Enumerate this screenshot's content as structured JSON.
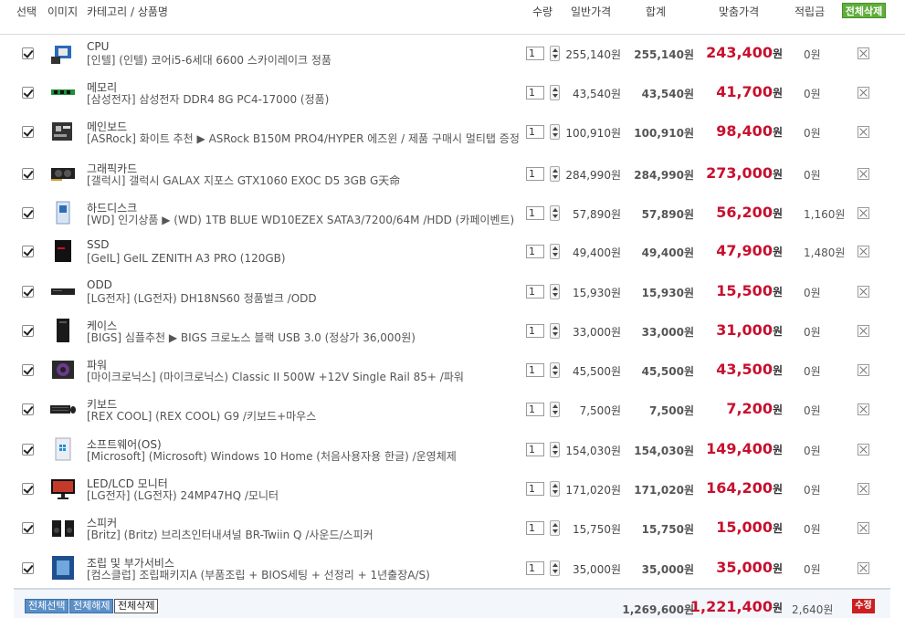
{
  "header": {
    "select": "선택",
    "image": "이미지",
    "category_product": "카테고리 / 상품명",
    "qty": "수량",
    "normal_price": "일반가격",
    "sum": "합계",
    "fit_price": "맞춤가격",
    "points": "적립금",
    "delete_all": "전체삭제"
  },
  "currency": "원",
  "items": [
    {
      "category": "CPU",
      "name": "[인텔] (인텔) 코어i5-6세대 6600 스카이레이크 정품",
      "qty": "1",
      "normal": "255,140원",
      "sum": "255,140원",
      "fit": "243,400",
      "points": "0원",
      "icon": "cpu-icon"
    },
    {
      "category": "메모리",
      "name": "[삼성전자] 삼성전자 DDR4 8G PC4-17000 (정품)",
      "qty": "1",
      "normal": "43,540원",
      "sum": "43,540원",
      "fit": "41,700",
      "points": "0원",
      "icon": "memory-icon"
    },
    {
      "category": "메인보드",
      "name": "[ASRock] 화이트 추천 ▶ ASRock B150M PRO4/HYPER 에즈윈 / 제품 구매시 멀티탭 증정",
      "qty": "1",
      "normal": "100,910원",
      "sum": "100,910원",
      "fit": "98,400",
      "points": "0원",
      "icon": "mainboard-icon"
    },
    {
      "category": "그래픽카드",
      "name": "[갤럭시] 갤럭시 GALAX 지포스 GTX1060 EXOC D5 3GB G天命",
      "qty": "1",
      "normal": "284,990원",
      "sum": "284,990원",
      "fit": "273,000",
      "points": "0원",
      "icon": "graphics-card-icon"
    },
    {
      "category": "하드디스크",
      "name": "[WD] 인기상품 ▶ (WD) 1TB BLUE WD10EZEX SATA3/7200/64M /HDD (카페이벤트)",
      "qty": "1",
      "normal": "57,890원",
      "sum": "57,890원",
      "fit": "56,200",
      "points": "1,160원",
      "icon": "hard-disk-icon"
    },
    {
      "category": "SSD",
      "name": "[GeIL] GeIL ZENITH A3 PRO (120GB)",
      "qty": "1",
      "normal": "49,400원",
      "sum": "49,400원",
      "fit": "47,900",
      "points": "1,480원",
      "icon": "ssd-icon"
    },
    {
      "category": "ODD",
      "name": "[LG전자] (LG전자) DH18NS60 정품벌크 /ODD",
      "qty": "1",
      "normal": "15,930원",
      "sum": "15,930원",
      "fit": "15,500",
      "points": "0원",
      "icon": "odd-icon"
    },
    {
      "category": "케이스",
      "name": "[BIGS] 심플추천 ▶ BIGS 크로노스 블랙 USB 3.0 (정상가 36,000원)",
      "qty": "1",
      "normal": "33,000원",
      "sum": "33,000원",
      "fit": "31,000",
      "points": "0원",
      "icon": "case-icon"
    },
    {
      "category": "파워",
      "name": "[마이크로닉스] (마이크로닉스) Classic II 500W +12V Single Rail 85+ /파워",
      "qty": "1",
      "normal": "45,500원",
      "sum": "45,500원",
      "fit": "43,500",
      "points": "0원",
      "icon": "power-supply-icon"
    },
    {
      "category": "키보드",
      "name": "[REX COOL] (REX COOL) G9 /키보드+마우스",
      "qty": "1",
      "normal": "7,500원",
      "sum": "7,500원",
      "fit": "7,200",
      "points": "0원",
      "icon": "keyboard-icon"
    },
    {
      "category": "소프트웨어(OS)",
      "name": "[Microsoft] (Microsoft) Windows 10 Home (처음사용자용 한글) /운영체제",
      "qty": "1",
      "normal": "154,030원",
      "sum": "154,030원",
      "fit": "149,400",
      "points": "0원",
      "icon": "windows-box-icon"
    },
    {
      "category": "LED/LCD 모니터",
      "name": "[LG전자] (LG전자) 24MP47HQ /모니터",
      "qty": "1",
      "normal": "171,020원",
      "sum": "171,020원",
      "fit": "164,200",
      "points": "0원",
      "icon": "monitor-icon"
    },
    {
      "category": "스피커",
      "name": "[Britz] (Britz) 브리츠인터내셔널 BR-Twiin Q /사운드/스피커",
      "qty": "1",
      "normal": "15,750원",
      "sum": "15,750원",
      "fit": "15,000",
      "points": "0원",
      "icon": "speaker-icon"
    },
    {
      "category": "조립 및 부가서비스",
      "name": "[컴스클럽] 조립패키지A (부품조립 + BIOS세팅 + 선정리 + 1년출장A/S)",
      "qty": "1",
      "normal": "35,000원",
      "sum": "35,000원",
      "fit": "35,000",
      "points": "0원",
      "icon": "assembly-service-icon"
    }
  ],
  "footer": {
    "select_all": "전체선택",
    "deselect_all": "전체해제",
    "delete_all": "전체삭제",
    "total_sum": "1,269,600원",
    "total_fit": "1,221,400",
    "total_points": "2,640원",
    "edit": "수정"
  }
}
